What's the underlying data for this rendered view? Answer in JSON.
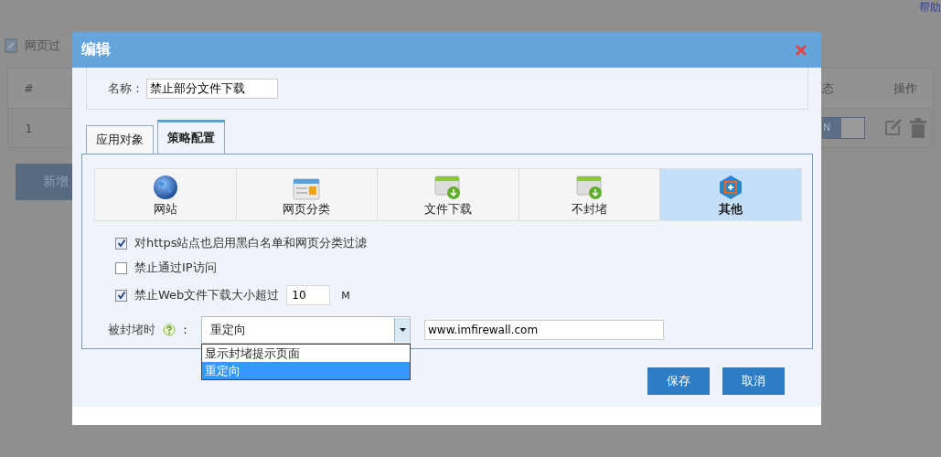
{
  "background_page": {
    "help_link": "帮助",
    "page_title": "网页过",
    "table": {
      "columns": [
        "#",
        "态",
        "操作"
      ],
      "rows": [
        {
          "index": "1",
          "toggle": "N",
          "on": true
        }
      ]
    },
    "add_button": "新增"
  },
  "dialog": {
    "title": "编辑",
    "name_label": "名称：",
    "name_value": "禁止部分文件下载",
    "tabs": [
      {
        "label": "应用对象",
        "selected": false
      },
      {
        "label": "策略配置",
        "selected": true
      }
    ],
    "categories": [
      {
        "label": "网站",
        "kind": "globe",
        "selected": false
      },
      {
        "label": "网页分类",
        "kind": "card",
        "selected": false
      },
      {
        "label": "文件下载",
        "kind": "download",
        "selected": false
      },
      {
        "label": "不封堵",
        "kind": "download",
        "selected": false
      },
      {
        "label": "其他",
        "kind": "hexagon",
        "selected": true
      }
    ],
    "options": [
      {
        "label": "对https站点也启用黑白名单和网页分类过滤",
        "checked": true
      },
      {
        "label": "禁止通过IP访问",
        "checked": false
      },
      {
        "label": "禁止Web文件下载大小超过",
        "checked": true,
        "value": "10",
        "unit": "M"
      }
    ],
    "blocked": {
      "label": "被封堵时",
      "colon": "：",
      "select_value": "重定向",
      "options": [
        {
          "label": "显示封堵提示页面",
          "selected": false
        },
        {
          "label": "重定向",
          "selected": true
        }
      ],
      "url": "www.imfirewall.com"
    },
    "buttons": [
      "保存",
      "取消"
    ]
  }
}
